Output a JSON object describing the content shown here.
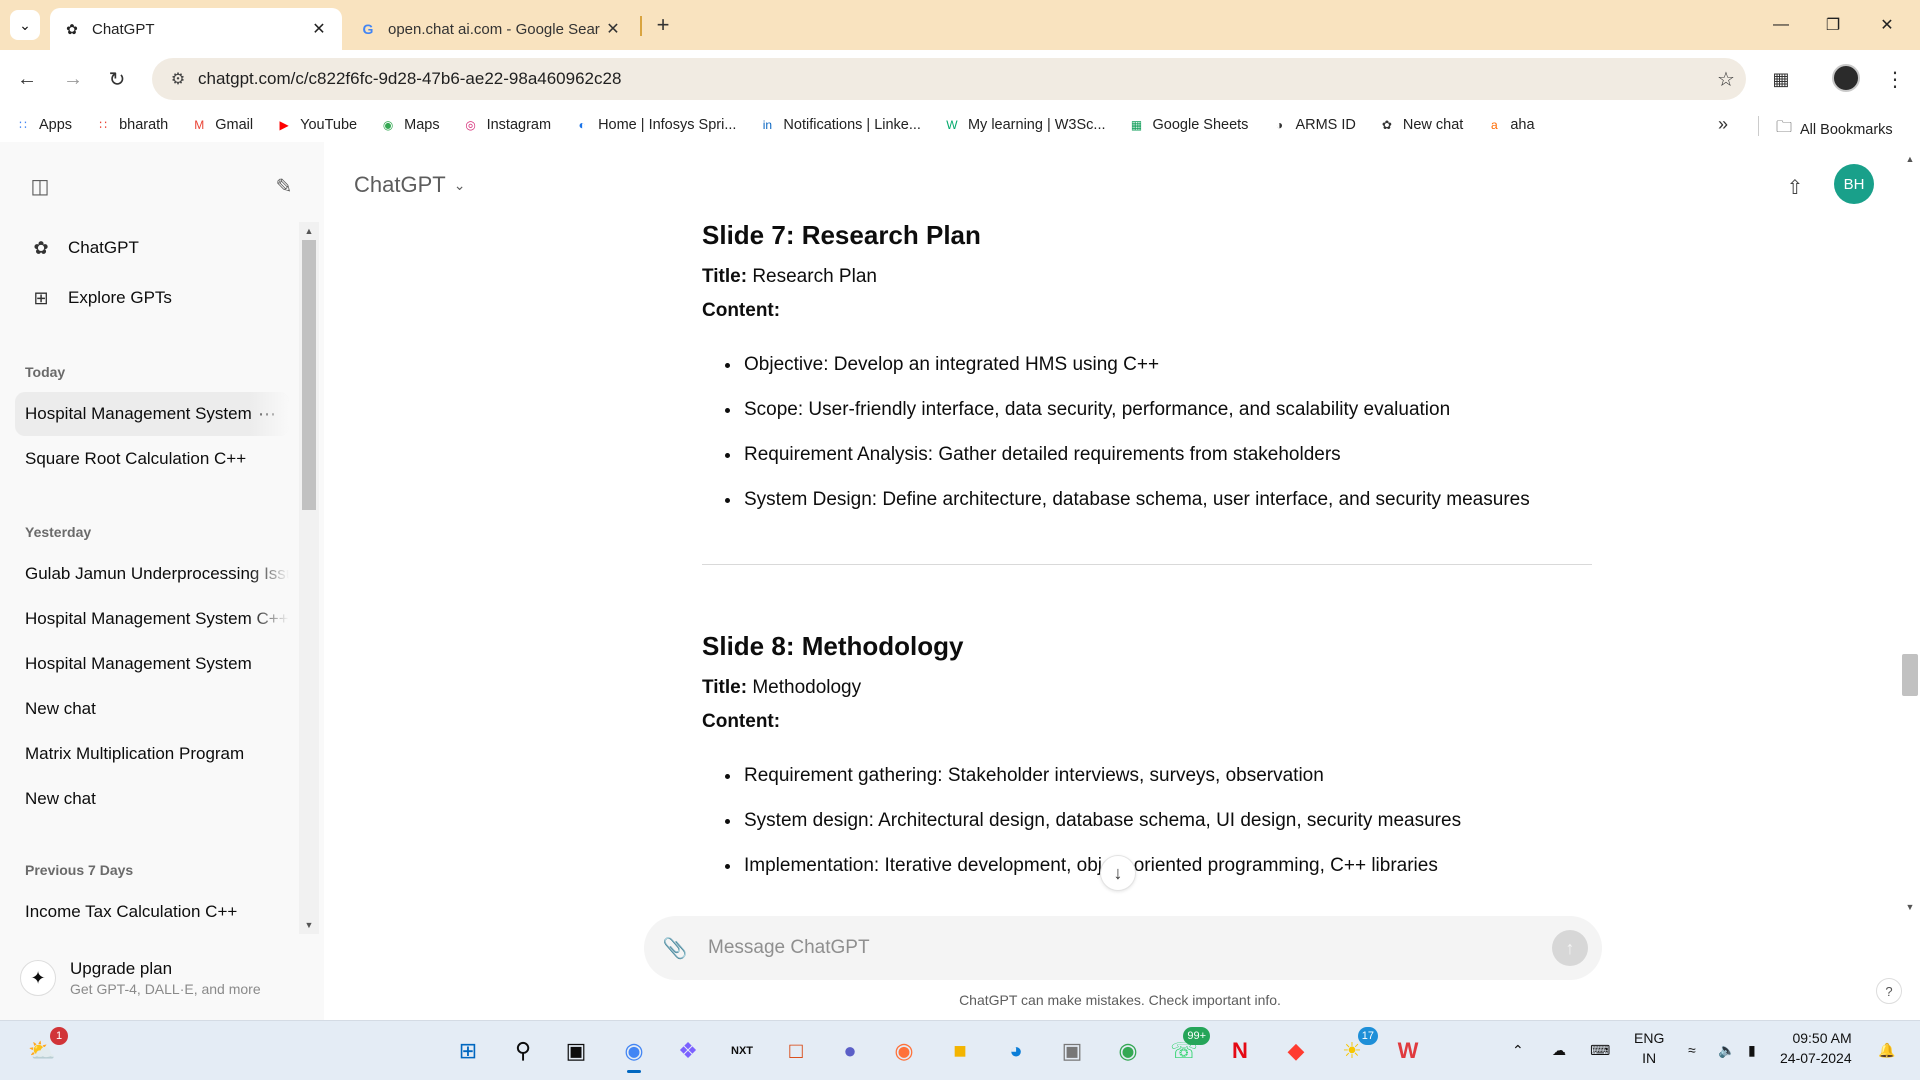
{
  "browser": {
    "tabs": [
      {
        "title": "ChatGPT",
        "favicon": "openai-icon",
        "active": true
      },
      {
        "title": "open.chat ai.com - Google Sear",
        "favicon": "google-icon",
        "active": false
      }
    ],
    "url": "chatgpt.com/c/c822f6fc-9d28-47b6-ae22-98a460962c28",
    "bookmarks": [
      {
        "label": "Apps",
        "icon": "apps-grid-icon",
        "color": "#4285f4"
      },
      {
        "label": "bharath",
        "icon": "apps-grid-icon",
        "color": "#ea4335"
      },
      {
        "label": "Gmail",
        "icon": "gmail-icon",
        "color": "#ea4335"
      },
      {
        "label": "YouTube",
        "icon": "youtube-icon",
        "color": "#ff0000"
      },
      {
        "label": "Maps",
        "icon": "maps-icon",
        "color": "#34a853"
      },
      {
        "label": "Instagram",
        "icon": "instagram-icon",
        "color": "#d62976"
      },
      {
        "label": "Home | Infosys Spri...",
        "icon": "infosys-icon",
        "color": "#1a73e8"
      },
      {
        "label": "Notifications | Linke...",
        "icon": "linkedin-icon",
        "color": "#0a66c2"
      },
      {
        "label": "My learning | W3Sc...",
        "icon": "w3schools-icon",
        "color": "#04aa6d"
      },
      {
        "label": "Google Sheets",
        "icon": "sheets-icon",
        "color": "#0f9d58"
      },
      {
        "label": "ARMS ID",
        "icon": "globe-icon",
        "color": "#333333"
      },
      {
        "label": "New chat",
        "icon": "openai-icon",
        "color": "#333333"
      },
      {
        "label": "aha",
        "icon": "aha-icon",
        "color": "#ff6a00"
      }
    ],
    "all_bookmarks": "All Bookmarks"
  },
  "sidebar": {
    "nav": [
      {
        "label": "ChatGPT",
        "icon": "openai-icon"
      },
      {
        "label": "Explore GPTs",
        "icon": "grid-icon"
      }
    ],
    "groups": [
      {
        "label": "Today",
        "items": [
          "Hospital Management System",
          "Square Root Calculation C++"
        ]
      },
      {
        "label": "Yesterday",
        "items": [
          "Gulab Jamun Underprocessing Issue",
          "Hospital Management System C++",
          "Hospital Management System",
          "New chat",
          "Matrix Multiplication Program",
          "New chat"
        ]
      },
      {
        "label": "Previous 7 Days",
        "items": [
          "Income Tax Calculation C++"
        ]
      }
    ],
    "upgrade": {
      "title": "Upgrade plan",
      "subtitle": "Get GPT-4, DALL·E, and more"
    }
  },
  "header": {
    "model": "ChatGPT",
    "avatar_initials": "BH",
    "avatar_color": "#19a08a"
  },
  "conversation": {
    "slides": [
      {
        "heading": "Slide 7: Research Plan",
        "title_label": "Title:",
        "title_value": "Research Plan",
        "content_label": "Content:",
        "bullets": [
          "Objective: Develop an integrated HMS using C++",
          "Scope: User-friendly interface, data security, performance, and scalability evaluation",
          "Requirement Analysis: Gather detailed requirements from stakeholders",
          "System Design: Define architecture, database schema, user interface, and security measures"
        ]
      },
      {
        "heading": "Slide 8: Methodology",
        "title_label": "Title:",
        "title_value": "Methodology",
        "content_label": "Content:",
        "bullets": [
          "Requirement gathering: Stakeholder interviews, surveys, observation",
          "System design: Architectural design, database schema, UI design, security measures",
          "Implementation: Iterative development, object-oriented programming, C++ libraries"
        ]
      }
    ]
  },
  "composer": {
    "placeholder": "Message ChatGPT"
  },
  "disclaimer": "ChatGPT can make mistakes. Check important info.",
  "taskbar": {
    "weather_badge": "1",
    "whatsapp_badge": "99+",
    "chat_badge": "17",
    "lang_line1": "ENG",
    "lang_line2": "IN",
    "time": "09:50 AM",
    "date": "24-07-2024"
  }
}
